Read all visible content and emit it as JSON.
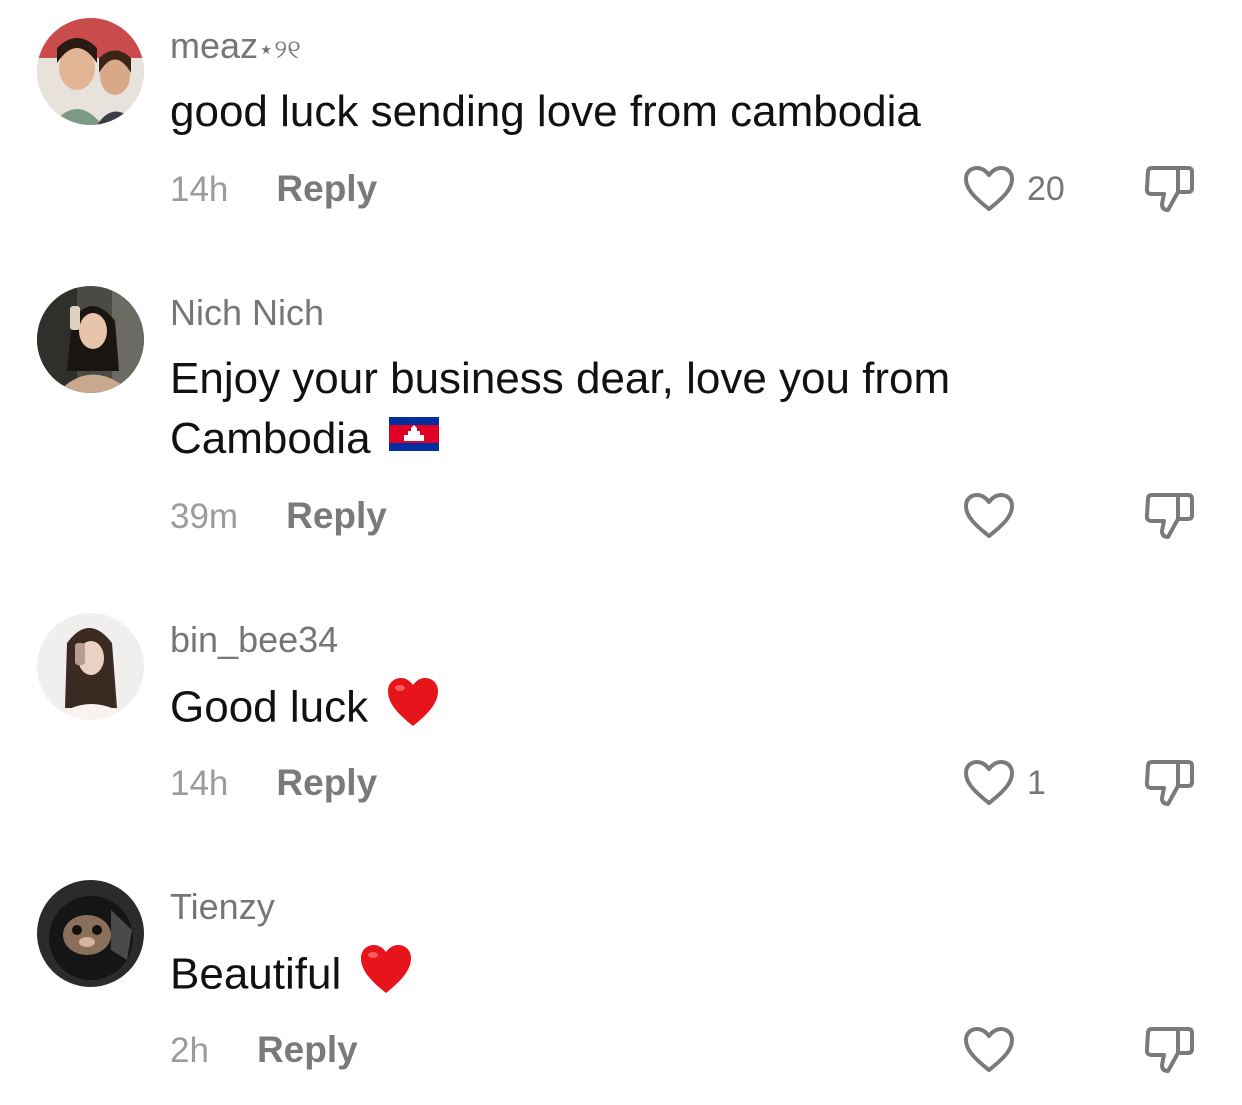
{
  "comments": [
    {
      "username": "meaz",
      "username_suffix": "⋆୨୧",
      "text": "good luck sending love from cambodia",
      "time": "14h",
      "reply_label": "Reply",
      "likes": "20",
      "avatar_icon": "user-avatar",
      "emoji": null
    },
    {
      "username": "Nich Nich",
      "username_suffix": "",
      "text": "Enjoy your business dear, love you from Cambodia",
      "time": "39m",
      "reply_label": "Reply",
      "likes": "",
      "avatar_icon": "user-avatar",
      "emoji": "cambodia-flag"
    },
    {
      "username": "bin_bee34",
      "username_suffix": "",
      "text": "Good luck",
      "time": "14h",
      "reply_label": "Reply",
      "likes": "1",
      "avatar_icon": "user-avatar",
      "emoji": "red-heart"
    },
    {
      "username": "Tienzy",
      "username_suffix": "",
      "text": "Beautiful",
      "time": "2h",
      "reply_label": "Reply",
      "likes": "",
      "avatar_icon": "user-avatar",
      "emoji": "red-heart"
    }
  ],
  "icons": {
    "like": "heart-outline-icon",
    "dislike": "thumbs-down-icon"
  },
  "colors": {
    "username": "#767676",
    "meta": "#9b9b9b",
    "icon": "#7a7a7a",
    "heart_emoji": "#e8141c"
  }
}
